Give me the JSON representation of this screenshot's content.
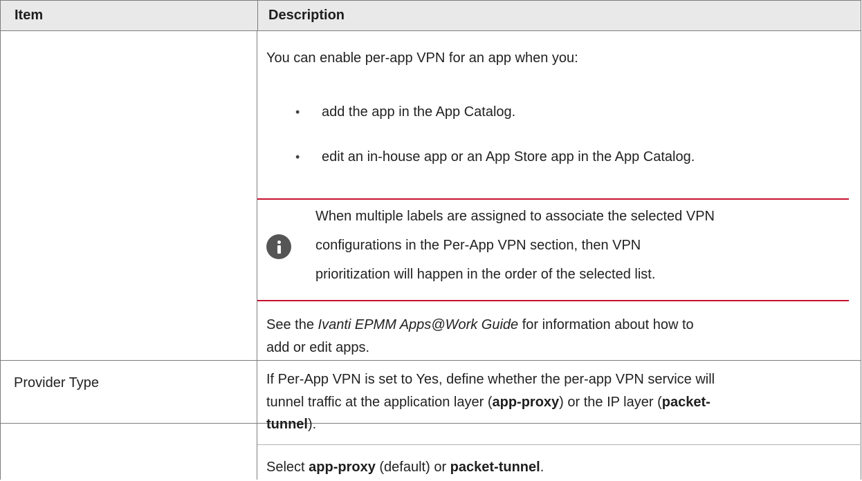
{
  "table": {
    "headers": {
      "item": "Item",
      "description": "Description"
    },
    "rows": [
      {
        "item": "",
        "intro": "You can enable per-app VPN for an app when you:",
        "bullets": [
          "add the app in the App Catalog.",
          "edit an in-house app or an App Store app in the App Catalog."
        ],
        "note": {
          "icon": "info-icon",
          "lines": [
            "When multiple labels are assigned to associate the selected VPN",
            "configurations in the Per-App VPN section, then VPN",
            "prioritization will happen in the order of the selected list."
          ]
        },
        "see": {
          "prefix": "See the ",
          "guide": "Ivanti EPMM Apps@Work Guide",
          "suffix": " for information about how to",
          "line2": "add or edit apps."
        }
      },
      {
        "item": "Provider Type",
        "para1": {
          "line1": "If Per-App VPN is set to Yes, define whether the per-app VPN service will",
          "line2_a": "tunnel traffic at the application layer (",
          "line2_b": "app-proxy",
          "line2_c": ") or the IP layer (",
          "line2_d": "packet-",
          "line3_a": "tunnel",
          "line3_b": ")."
        },
        "para2": {
          "a": "Select ",
          "b": "app-proxy",
          "c": " (default) or ",
          "d": "packet-tunnel",
          "e": "."
        }
      }
    ]
  },
  "colors": {
    "header_bg": "#e9e9e9",
    "border": "#7d7d7d",
    "note_rule": "#c8102e",
    "icon": "#555555"
  }
}
